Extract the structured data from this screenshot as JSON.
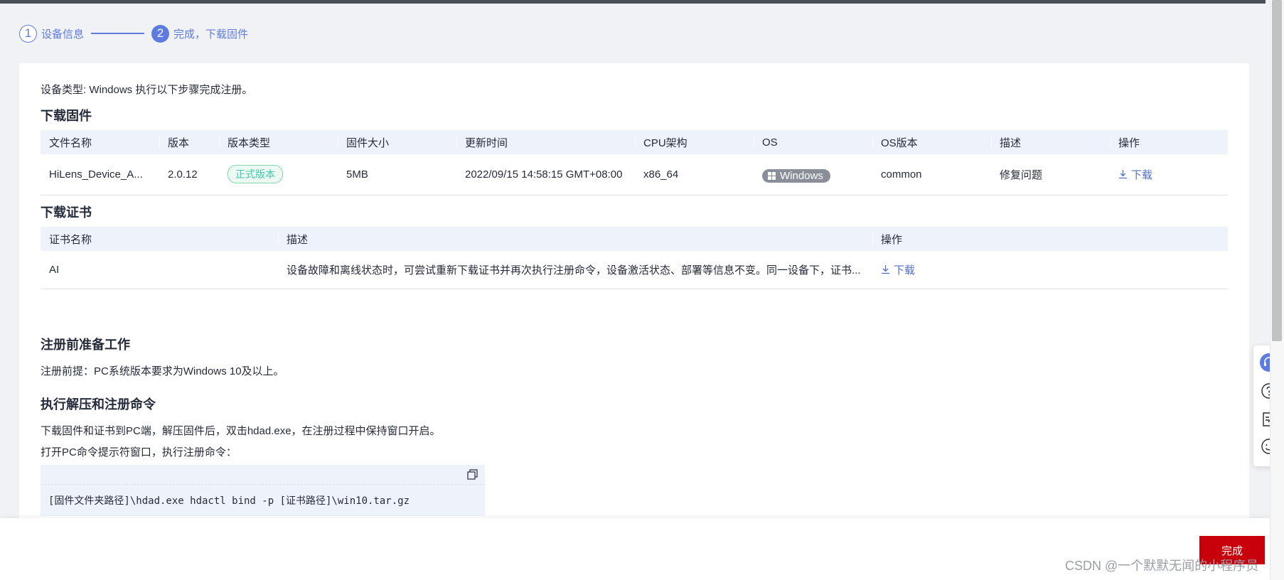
{
  "stepper": {
    "step1_num": "1",
    "step1_label": "设备信息",
    "step2_num": "2",
    "step2_label": "完成，下载固件"
  },
  "device_type_text": "设备类型: Windows 执行以下步骤完成注册。",
  "firmware": {
    "title": "下载固件",
    "headers": [
      "文件名称",
      "版本",
      "版本类型",
      "固件大小",
      "更新时间",
      "CPU架构",
      "OS",
      "OS版本",
      "描述",
      "操作"
    ],
    "row": {
      "file_name": "HiLens_Device_A...",
      "version": "2.0.12",
      "version_type": "正式版本",
      "size": "5MB",
      "updated": "2022/09/15 14:58:15 GMT+08:00",
      "cpu": "x86_64",
      "os": "Windows",
      "os_version": "common",
      "description": "修复问题",
      "action": "下载"
    }
  },
  "certificate": {
    "title": "下载证书",
    "headers": [
      "证书名称",
      "描述",
      "操作"
    ],
    "row": {
      "name": "AI",
      "description": "设备故障和离线状态时，可尝试重新下载证书并再次执行注册命令，设备激活状态、部署等信息不变。同一设备下，证书...",
      "action": "下载"
    }
  },
  "prep": {
    "title": "注册前准备工作",
    "text": "注册前提：PC系统版本要求为Windows 10及以上。"
  },
  "exec": {
    "title": "执行解压和注册命令",
    "text1": "下载固件和证书到PC端，解压固件后，双击hdad.exe，在注册过程中保持窗口开启。",
    "text2": "打开PC命令提示符窗口，执行注册命令：",
    "command": "[固件文件夹路径]\\hdad.exe hdactl bind -p [证书路径]\\win10.tar.gz"
  },
  "footer": {
    "done_label": "完成",
    "watermark": "CSDN @一个默默无闻的小程序员"
  },
  "icons": {
    "download": "download-icon",
    "copy": "copy-icon",
    "windows": "windows-icon",
    "support": "headset-icon",
    "help": "question-icon",
    "feedback": "edit-note-icon",
    "satisfaction": "smile-icon"
  },
  "colors": {
    "accent": "#5e7ce0",
    "link": "#526ecc",
    "primary_button": "#c7000b",
    "success_tag": "#3dcca6"
  }
}
